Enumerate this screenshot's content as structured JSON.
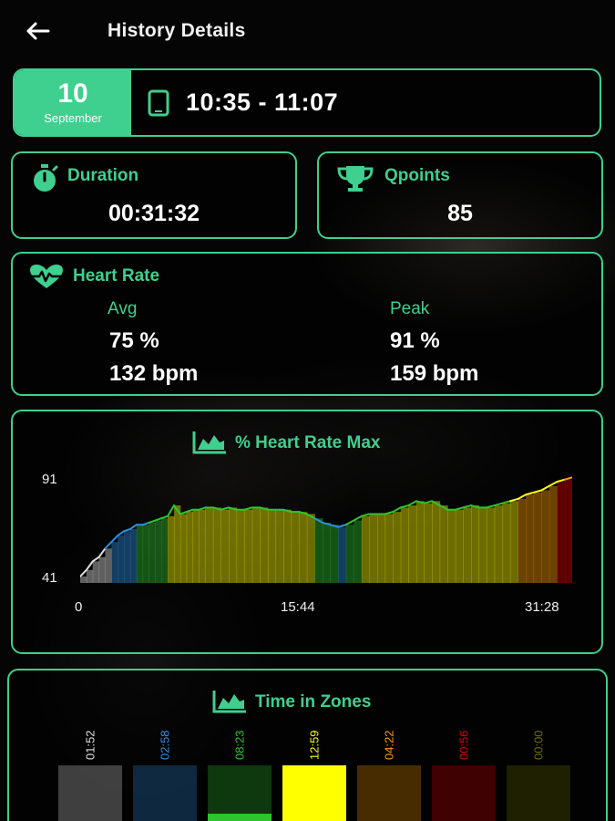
{
  "header": {
    "back_icon": "arrow-left-icon",
    "title": "History Details"
  },
  "session": {
    "day": "10",
    "month": "September",
    "device_icon": "tablet-icon",
    "time_range": "10:35 - 11:07"
  },
  "duration": {
    "icon": "stopwatch-icon",
    "label": "Duration",
    "value": "00:31:32"
  },
  "qpoints": {
    "icon": "trophy-icon",
    "label": "Qpoints",
    "value": "85"
  },
  "heart_rate": {
    "icon": "heartbeat-icon",
    "label": "Heart Rate",
    "avg_label": "Avg",
    "avg_percent": "75 %",
    "avg_bpm": "132 bpm",
    "peak_label": "Peak",
    "peak_percent": "91 %",
    "peak_bpm": "159 bpm"
  },
  "colors": {
    "accent": "#3fcf8e",
    "zone_grey": "#e0e0e0",
    "zone_blue": "#2f8fe0",
    "zone_green": "#2fc42f",
    "zone_yellow": "#ffff00",
    "zone_orange": "#ff9a00",
    "zone_red": "#e00000"
  },
  "chart_data": {
    "type": "line",
    "title": "% Heart Rate Max",
    "title_icon": "area-chart-icon",
    "x_tick_labels": [
      "0",
      "15:44",
      "31:28"
    ],
    "y_tick_labels": [
      "91",
      "41"
    ],
    "ylim": [
      41,
      91
    ],
    "xlim_minutes": [
      0,
      31.47
    ],
    "series": [
      {
        "x_minutes": [
          0,
          0.4,
          0.8,
          1.2,
          1.6,
          2.0,
          2.4,
          2.8,
          3.2,
          3.6,
          4.0,
          4.4,
          4.8,
          5.2,
          5.6,
          6.0,
          6.4,
          6.8,
          7.2,
          7.6,
          8.0,
          8.5,
          9.0,
          9.5,
          10.0,
          10.5,
          11.0,
          11.5,
          12.0,
          12.5,
          13.0,
          13.5,
          14.0,
          14.5,
          15.0,
          15.5,
          16.0,
          16.5,
          17.0,
          17.5,
          18.0,
          18.5,
          19.0,
          19.5,
          20.0,
          20.5,
          21.0,
          21.5,
          22.0,
          22.5,
          23.0,
          23.5,
          24.0,
          24.5,
          25.0,
          25.5,
          26.0,
          26.5,
          27.0,
          27.5,
          28.0,
          28.5,
          29.0,
          29.5,
          30.0,
          30.5,
          31.0,
          31.47
        ],
        "y_percent": [
          44,
          47,
          51,
          53,
          57,
          60,
          63,
          65,
          66,
          68,
          68,
          69,
          70,
          71,
          72,
          77,
          73,
          74,
          75,
          75,
          76,
          76,
          75,
          76,
          75,
          75,
          76,
          76,
          75,
          75,
          75,
          74,
          74,
          73,
          71,
          69,
          68,
          67,
          68,
          70,
          72,
          73,
          73,
          73,
          74,
          76,
          77,
          79,
          78,
          79,
          77,
          75,
          75,
          76,
          77,
          76,
          76,
          77,
          78,
          79,
          80,
          82,
          83,
          84,
          86,
          88,
          89,
          90
        ]
      }
    ],
    "zone_thresholds_percent": [
      50,
      60,
      70,
      80,
      90
    ]
  },
  "zones": {
    "title": "Time in Zones",
    "title_icon": "area-chart-icon",
    "items": [
      {
        "time": "01:52",
        "color": "#e0e0e0",
        "fill": 0.0
      },
      {
        "time": "02:58",
        "color": "#2f8fe0",
        "fill": 0.0
      },
      {
        "time": "08:23",
        "color": "#2fc42f",
        "fill": 0.18
      },
      {
        "time": "12:59",
        "color": "#ffff00",
        "fill": 1.0
      },
      {
        "time": "04:22",
        "color": "#ff9a00",
        "fill": 0.0
      },
      {
        "time": "00:56",
        "color": "#e00000",
        "fill": 0.0
      },
      {
        "time": "00:00",
        "color": "#6b6b00",
        "fill": 0.0
      }
    ]
  }
}
